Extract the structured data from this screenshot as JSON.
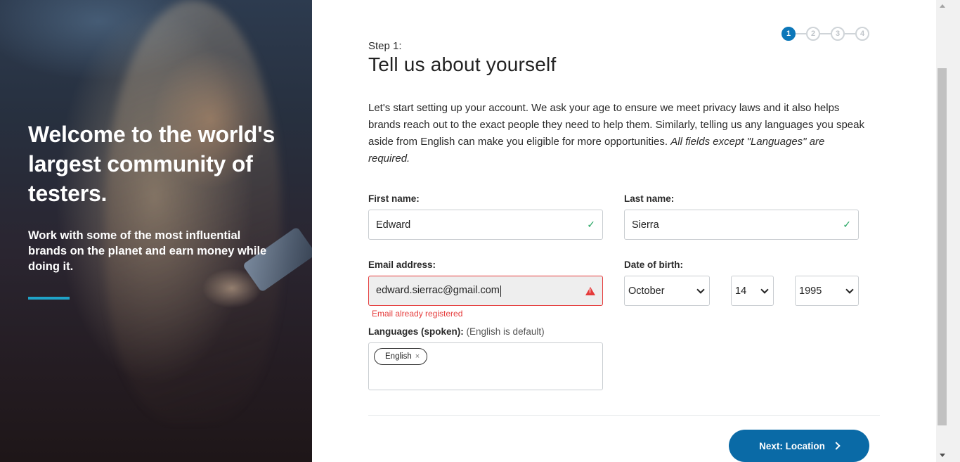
{
  "hero": {
    "title": "Welcome to the world's largest community of testers.",
    "subtitle": "Work with some of the most influential brands on the planet and earn money while doing it.",
    "accent_color": "#1fa3c8"
  },
  "stepper": {
    "steps": [
      "1",
      "2",
      "3",
      "4"
    ],
    "active_step": 1,
    "active_color": "#0c77b9"
  },
  "form": {
    "step_label": "Step 1:",
    "title": "Tell us about yourself",
    "intro": "Let's start setting up your account. We ask your age to ensure we meet privacy laws and it also helps brands reach out to the exact people they need to help them. Similarly, telling us any languages you speak aside from English can make you eligible for more opportunities.",
    "intro_note": "All fields except \"Languages\" are required.",
    "first_name": {
      "label": "First name:",
      "value": "Edward",
      "status": "valid"
    },
    "last_name": {
      "label": "Last name:",
      "value": "Sierra",
      "status": "valid"
    },
    "email": {
      "label": "Email address:",
      "value": "edward.sierrac@gmail.com",
      "status": "error",
      "error": "Email already registered",
      "error_color": "#e53b3b"
    },
    "dob": {
      "label": "Date of birth:",
      "month": "October",
      "day": "14",
      "year": "1995"
    },
    "languages": {
      "label": "Languages (spoken):",
      "hint": "(English is default)",
      "chips": [
        "English"
      ],
      "remove_glyph": "×"
    },
    "next_button": "Next: Location",
    "button_color": "#0a6aa6"
  }
}
